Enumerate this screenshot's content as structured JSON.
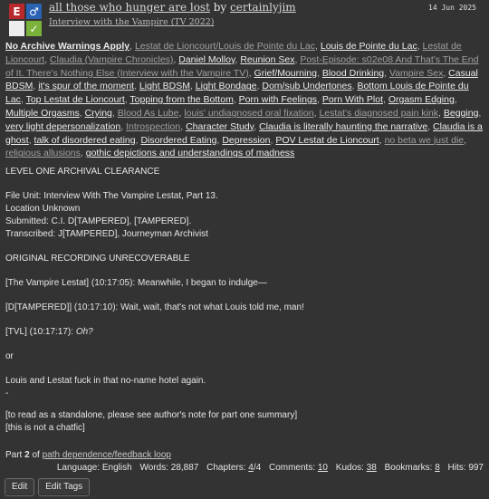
{
  "header": {
    "required_tags": {
      "rating": "E",
      "category": "♂",
      "warning": "",
      "complete": "✓"
    },
    "title": "all those who hunger are lost",
    "by": "by",
    "author": "certainlyjim",
    "fandom": "Interview with the Vampire (TV 2022)",
    "date": "14 Jun 2025"
  },
  "tags": [
    {
      "text": "No Archive Warnings Apply",
      "style": "warn"
    },
    {
      "text": "Lestat de Lioncourt/Louis de Pointe du Lac",
      "style": "dim"
    },
    {
      "text": "Louis de Pointe du Lac",
      "style": "normal"
    },
    {
      "text": "Lestat de Lioncourt",
      "style": "dim"
    },
    {
      "text": "Claudia (Vampire Chronicles)",
      "style": "dim"
    },
    {
      "text": "Daniel Molloy",
      "style": "normal"
    },
    {
      "text": "Reunion Sex",
      "style": "normal"
    },
    {
      "text": "Post-Episode: s02e08 And That's The End of It. There's Nothing Else (Interview with the Vampire TV)",
      "style": "dim"
    },
    {
      "text": "Grief/Mourning",
      "style": "normal"
    },
    {
      "text": "Blood Drinking",
      "style": "normal"
    },
    {
      "text": "Vampire Sex",
      "style": "dim"
    },
    {
      "text": "Casual BDSM",
      "style": "normal"
    },
    {
      "text": "it's spur of the moment",
      "style": "normal"
    },
    {
      "text": "Light BDSM",
      "style": "normal"
    },
    {
      "text": "Light Bondage",
      "style": "normal"
    },
    {
      "text": "Dom/sub Undertones",
      "style": "normal"
    },
    {
      "text": "Bottom Louis de Pointe du Lac",
      "style": "normal"
    },
    {
      "text": "Top Lestat de Lioncourt",
      "style": "normal"
    },
    {
      "text": "Topping from the Bottom",
      "style": "normal"
    },
    {
      "text": "Porn with Feelings",
      "style": "normal"
    },
    {
      "text": "Porn With Plot",
      "style": "normal"
    },
    {
      "text": "Orgasm Edging",
      "style": "normal"
    },
    {
      "text": "Multiple Orgasms",
      "style": "normal"
    },
    {
      "text": "Crying",
      "style": "normal"
    },
    {
      "text": "Blood As Lube",
      "style": "dim"
    },
    {
      "text": "louis' undiagnosed oral fixation",
      "style": "dim"
    },
    {
      "text": "Lestat's diagnosed pain kink",
      "style": "dim"
    },
    {
      "text": "Begging",
      "style": "normal"
    },
    {
      "text": "very light depersonalization",
      "style": "normal"
    },
    {
      "text": "Introspection",
      "style": "dim"
    },
    {
      "text": "Character Study",
      "style": "normal"
    },
    {
      "text": "Claudia is literally haunting the narrative",
      "style": "normal"
    },
    {
      "text": "Claudia is a ghost",
      "style": "normal"
    },
    {
      "text": "talk of disordered eating",
      "style": "normal"
    },
    {
      "text": "Disordered Eating",
      "style": "normal"
    },
    {
      "text": "Depression",
      "style": "normal"
    },
    {
      "text": "POV Lestat de Lioncourt",
      "style": "normal"
    },
    {
      "text": "no beta we just die",
      "style": "dim"
    },
    {
      "text": "religious allusions",
      "style": "dim"
    },
    {
      "text": "gothic depictions and understandings of madness",
      "style": "normal"
    }
  ],
  "summary": {
    "clearance": "LEVEL ONE ARCHIVAL CLEARANCE",
    "file_unit": "File Unit: Interview With The Vampire Lestat, Part 13.",
    "location": "Location Unknown",
    "submitted": "Submitted: C.I. D[TAMPERED], [TAMPERED].",
    "transcribed": "Transcribed: J[TAMPERED], Journeyman Archivist",
    "original": "ORIGINAL RECORDING UNRECOVERABLE",
    "line1": "[The Vampire Lestat] (10:17:05): Meanwhile, I began to indulge—",
    "line2": "[D[TAMPERED]] (10:17:10): Wait, wait, that's not what Louis told me, man!",
    "line3_prefix": "[TVL] (10:17:17): ",
    "line3_em": "Oh?",
    "or": "or",
    "alt": "Louis and Lestat fuck in that no-name hotel again.",
    "dash": "-",
    "note1": "[to read as a standalone, please see author's note for part one summary]",
    "note2": "[this is not a chatfic]"
  },
  "series": {
    "part_label": "Part",
    "part_num": "2",
    "of": "of",
    "name": "path dependence/feedback loop"
  },
  "stats": {
    "language_label": "Language:",
    "language": "English",
    "words_label": "Words:",
    "words": "28,887",
    "chapters_label": "Chapters:",
    "chapters_current": "4",
    "chapters_total": "/4",
    "comments_label": "Comments:",
    "comments": "10",
    "kudos_label": "Kudos:",
    "kudos": "38",
    "bookmarks_label": "Bookmarks:",
    "bookmarks": "8",
    "hits_label": "Hits:",
    "hits": "997"
  },
  "buttons": {
    "edit": "Edit",
    "edit_tags": "Edit Tags"
  },
  "colors": {
    "background": "#333333",
    "rating_red": "#b8282d",
    "category_blue": "#2a62b4",
    "complete_green": "#7bb23a"
  }
}
